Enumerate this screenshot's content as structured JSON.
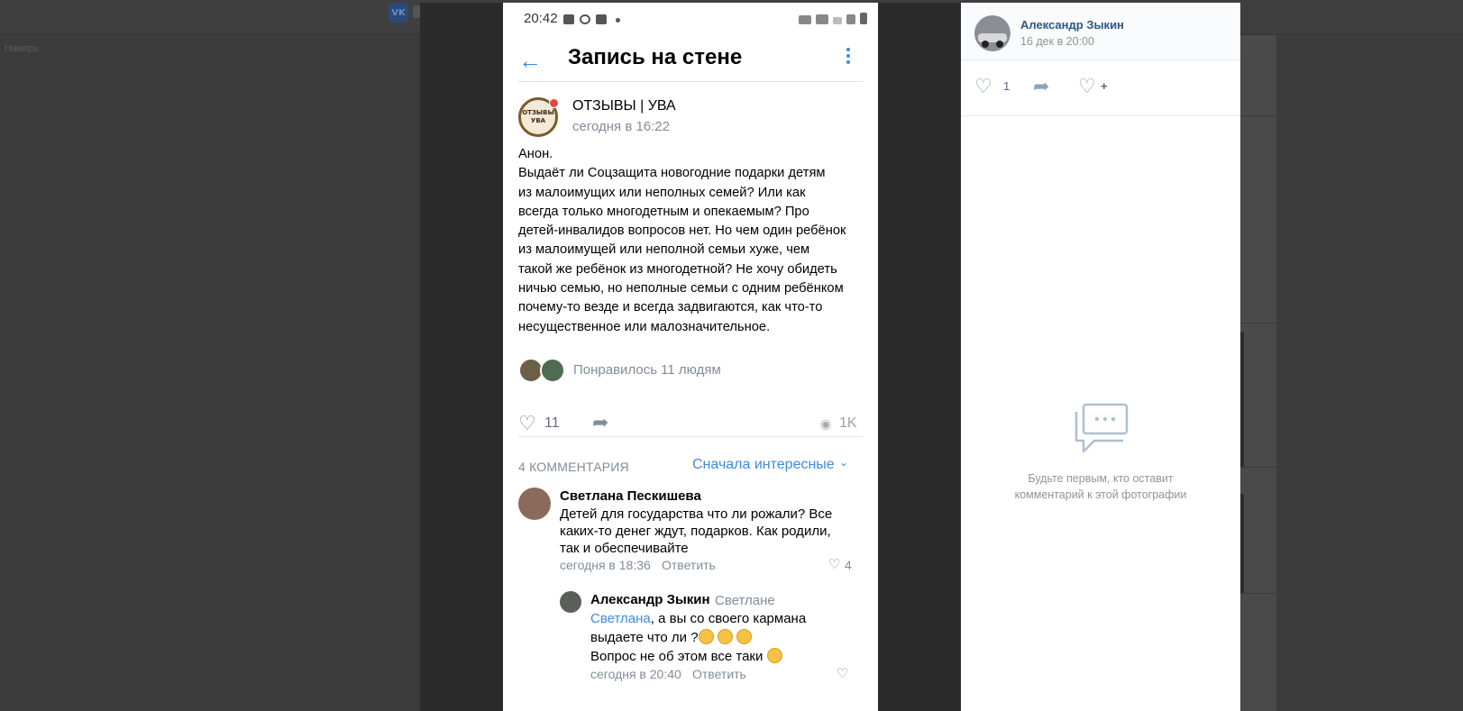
{
  "background": {
    "nav_label": "Наверх"
  },
  "phone": {
    "status_time": "20:42",
    "header_title": "Запись на стене",
    "post": {
      "author": "ОТЗЫВЫ | УВА",
      "avatar_text": "ОТЗЫВЫ УВА",
      "date": "сегодня в 16:22",
      "text_lines": [
        "Анон.",
        "Выдаёт ли Соцзащита новогодние подарки детям",
        "из малоимущих или неполных семей? Или как",
        "всегда только многодетным и опекаемым? Про",
        "детей-инвалидов вопросов нет. Но чем один ребёнок",
        "из малоимущей или неполной семьи хуже, чем",
        "такой же ребёнок из многодетной? Не хочу обидеть",
        "ничью семью, но неполные семьи с одним ребёнком",
        "почему-то везде и всегда задвигаются, как что-то",
        "несущественное или малозначительное."
      ],
      "liked_by": "Понравилось 11 людям",
      "likes": "11",
      "views": "1K"
    },
    "comments_header": {
      "count_label": "4 КОММЕНТАРИЯ",
      "sort_label": "Сначала интересные"
    },
    "comments": [
      {
        "author": "Светлана Пескишева",
        "text_lines": [
          "Детей для государства что ли рожали? Все",
          "каких-то денег ждут, подарков. Как родили,",
          "так и обеспечивайте"
        ],
        "date": "сегодня в 18:36",
        "reply_label": "Ответить",
        "likes": "4"
      },
      {
        "author": "Александр Зыкин",
        "reply_to": "Светлане",
        "mention": "Светлана",
        "text_1": ", а вы со своего кармана",
        "text_2": "выдаете что ли ?",
        "text_3": "Вопрос не об этом все таки",
        "date": "сегодня в 20:40",
        "reply_label": "Ответить"
      }
    ]
  },
  "side_panel": {
    "author": "Александр Зыкин",
    "date": "16 дек в 20:00",
    "likes": "1",
    "favorite_plus": "+",
    "empty_line_1": "Будьте первым, кто оставит",
    "empty_line_2": "комментарий к этой фотографии"
  },
  "colors": {
    "accent": "#3f8ae0",
    "link_dark": "#2a5885",
    "muted": "#818c99",
    "overlay": "#2b2b2b"
  },
  "icons": [
    "back-arrow-icon",
    "more-vertical-icon",
    "heart-icon",
    "share-icon",
    "eye-icon",
    "chevron-down-icon",
    "comments-empty-icon",
    "favorite-heart-icon"
  ]
}
